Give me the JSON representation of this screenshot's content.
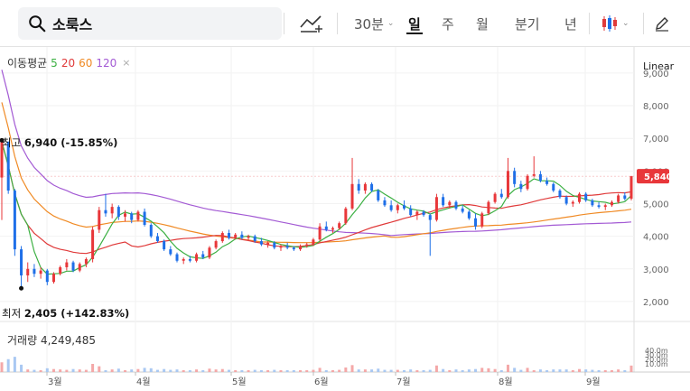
{
  "search": {
    "query": "소룩스"
  },
  "toolbar": {
    "interval": "30분",
    "periods": [
      "일",
      "주",
      "월",
      "분기",
      "년"
    ],
    "selected_period": "일"
  },
  "legend": {
    "label": "이동평균",
    "ma": [
      {
        "period": "5",
        "color": "#3cb043"
      },
      {
        "period": "20",
        "color": "#e03a3a"
      },
      {
        "period": "60",
        "color": "#f08a24"
      },
      {
        "period": "120",
        "color": "#a35ad4"
      }
    ]
  },
  "scale": {
    "label": "Linear"
  },
  "price": {
    "current": "5,840"
  },
  "annotations": {
    "high": {
      "label": "최고",
      "value": "6,940 (-15.85%)"
    },
    "low": {
      "label": "최저",
      "value": "2,405 (+142.83%)"
    }
  },
  "volume": {
    "label": "거래량",
    "value": "4,249,485",
    "ticks": [
      "40.0m",
      "30.0m",
      "20.0m",
      "10.0m"
    ]
  },
  "chart_data": {
    "type": "candlestick",
    "yticks": [
      "9,000",
      "8,000",
      "7,000",
      "6,000",
      "5,000",
      "4,000",
      "3,000",
      "2,000"
    ],
    "ylim": [
      1500,
      9800
    ],
    "months": [
      "3월",
      "4월",
      "5월",
      "6월",
      "7월",
      "8월",
      "9월"
    ],
    "high": 6940,
    "low": 2405,
    "last": 5840,
    "ohlc": [
      [
        5800,
        6940,
        4500,
        6900
      ],
      [
        6900,
        6900,
        5300,
        5400
      ],
      [
        5400,
        5450,
        3400,
        3600
      ],
      [
        3600,
        3700,
        2405,
        2800
      ],
      [
        2800,
        3200,
        2600,
        3000
      ],
      [
        3000,
        3150,
        2750,
        2850
      ],
      [
        2850,
        3050,
        2700,
        2950
      ],
      [
        2950,
        3000,
        2500,
        2600
      ],
      [
        2600,
        2900,
        2550,
        2850
      ],
      [
        2850,
        3100,
        2800,
        3050
      ],
      [
        3050,
        3300,
        2950,
        3200
      ],
      [
        3200,
        3250,
        2900,
        2950
      ],
      [
        2950,
        3200,
        2900,
        3150
      ],
      [
        3150,
        3350,
        3050,
        3300
      ],
      [
        3300,
        4300,
        3200,
        4200
      ],
      [
        4200,
        4900,
        4100,
        4800
      ],
      [
        4800,
        5300,
        4600,
        4700
      ],
      [
        4700,
        5000,
        4550,
        4900
      ],
      [
        4900,
        4950,
        4500,
        4600
      ],
      [
        4600,
        4800,
        4450,
        4700
      ],
      [
        4700,
        4750,
        4400,
        4500
      ],
      [
        4500,
        4800,
        4450,
        4750
      ],
      [
        4750,
        4850,
        4300,
        4350
      ],
      [
        4350,
        4400,
        3950,
        4000
      ],
      [
        4000,
        4100,
        3800,
        3850
      ],
      [
        3850,
        3900,
        3550,
        3600
      ],
      [
        3600,
        3700,
        3400,
        3450
      ],
      [
        3450,
        3500,
        3200,
        3250
      ],
      [
        3250,
        3350,
        3150,
        3300
      ],
      [
        3300,
        3400,
        3200,
        3250
      ],
      [
        3250,
        3500,
        3200,
        3450
      ],
      [
        3450,
        3550,
        3300,
        3350
      ],
      [
        3350,
        3700,
        3300,
        3650
      ],
      [
        3650,
        3900,
        3600,
        3850
      ],
      [
        3850,
        4150,
        3800,
        4100
      ],
      [
        4100,
        4200,
        3900,
        3950
      ],
      [
        3950,
        4100,
        3900,
        4050
      ],
      [
        4050,
        4150,
        3900,
        3950
      ],
      [
        3950,
        4050,
        3850,
        4000
      ],
      [
        4000,
        4050,
        3800,
        3850
      ],
      [
        3850,
        3950,
        3700,
        3750
      ],
      [
        3750,
        3850,
        3650,
        3800
      ],
      [
        3800,
        3850,
        3600,
        3650
      ],
      [
        3650,
        3750,
        3550,
        3700
      ],
      [
        3700,
        3800,
        3600,
        3650
      ],
      [
        3650,
        3700,
        3550,
        3600
      ],
      [
        3600,
        3750,
        3550,
        3700
      ],
      [
        3700,
        3800,
        3650,
        3750
      ],
      [
        3750,
        3950,
        3700,
        3900
      ],
      [
        3900,
        4400,
        3850,
        4300
      ],
      [
        4300,
        4450,
        4150,
        4200
      ],
      [
        4200,
        4300,
        4100,
        4250
      ],
      [
        4250,
        4450,
        4200,
        4400
      ],
      [
        4400,
        4900,
        4350,
        4850
      ],
      [
        4850,
        6400,
        4800,
        5600
      ],
      [
        5600,
        5750,
        5300,
        5400
      ],
      [
        5400,
        5650,
        5300,
        5600
      ],
      [
        5600,
        5650,
        5350,
        5400
      ],
      [
        5400,
        5450,
        5050,
        5100
      ],
      [
        5100,
        5200,
        4900,
        4950
      ],
      [
        4950,
        5100,
        4750,
        4800
      ],
      [
        4800,
        5000,
        4700,
        4950
      ],
      [
        4950,
        5100,
        4800,
        4850
      ],
      [
        4850,
        4950,
        4600,
        4650
      ],
      [
        4650,
        4800,
        4500,
        4750
      ],
      [
        4750,
        4800,
        4600,
        4650
      ],
      [
        4650,
        4700,
        3400,
        4500
      ],
      [
        4500,
        5300,
        4450,
        5200
      ],
      [
        5200,
        5300,
        4900,
        4950
      ],
      [
        4950,
        5100,
        4850,
        5050
      ],
      [
        5050,
        5100,
        4800,
        4850
      ],
      [
        4850,
        4950,
        4700,
        4750
      ],
      [
        4750,
        4800,
        4500,
        4550
      ],
      [
        4550,
        4700,
        4200,
        4300
      ],
      [
        4300,
        4750,
        4250,
        4700
      ],
      [
        4700,
        5100,
        4650,
        5050
      ],
      [
        5050,
        5350,
        5000,
        5300
      ],
      [
        5300,
        5450,
        5150,
        5200
      ],
      [
        5200,
        6400,
        5150,
        6000
      ],
      [
        6000,
        6100,
        5500,
        5600
      ],
      [
        5600,
        5700,
        5350,
        5450
      ],
      [
        5450,
        5900,
        5400,
        5850
      ],
      [
        5850,
        6450,
        5800,
        5900
      ],
      [
        5900,
        6000,
        5650,
        5700
      ],
      [
        5700,
        5800,
        5550,
        5600
      ],
      [
        5600,
        5650,
        5350,
        5400
      ],
      [
        5400,
        5450,
        5150,
        5200
      ],
      [
        5200,
        5250,
        4950,
        5000
      ],
      [
        5000,
        5100,
        4900,
        5050
      ],
      [
        5050,
        5350,
        5000,
        5300
      ],
      [
        5300,
        5350,
        5050,
        5100
      ],
      [
        5100,
        5150,
        4900,
        4950
      ],
      [
        4950,
        5050,
        4850,
        4900
      ],
      [
        4900,
        5000,
        4800,
        4950
      ],
      [
        4950,
        5100,
        4900,
        5050
      ],
      [
        5050,
        5300,
        5000,
        5250
      ],
      [
        5250,
        5350,
        5100,
        5150
      ],
      [
        5150,
        5850,
        5100,
        5840
      ]
    ]
  }
}
